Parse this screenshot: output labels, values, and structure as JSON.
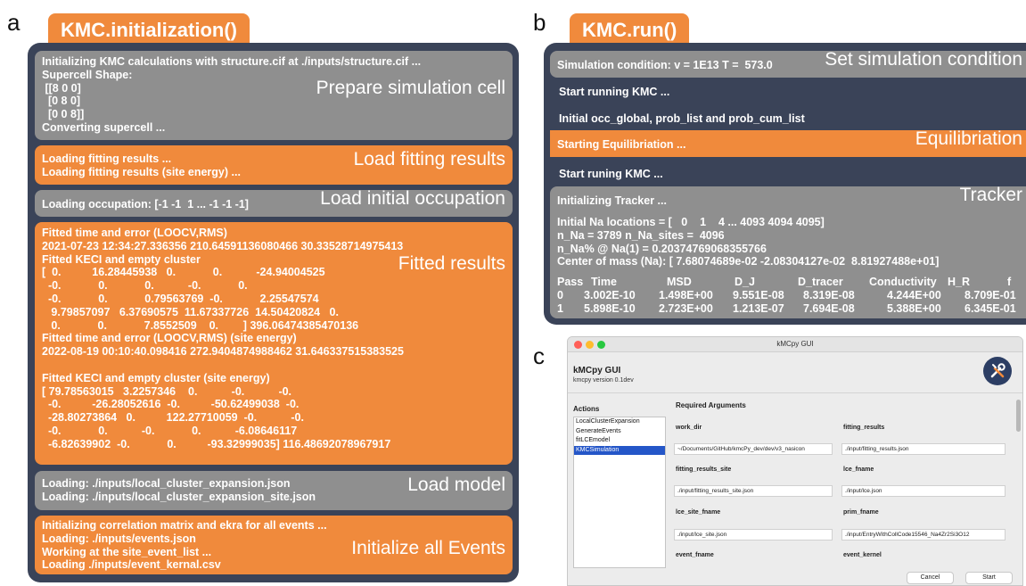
{
  "panel_a": {
    "letter": "a",
    "tab_title": "KMC.initialization()",
    "sections": [
      {
        "lines": [
          "Initializing KMC calculations with structure.cif at ./inputs/structure.cif ...",
          "Supercell Shape:",
          " [[8 0 0]",
          "  [0 8 0]",
          "  [0 0 8]]",
          "Converting supercell ..."
        ],
        "tag": "Prepare simulation cell"
      },
      {
        "lines": [
          "Loading fitting results ...",
          "Loading fitting results (site energy) ..."
        ],
        "tag": "Load fitting results"
      },
      {
        "lines": [
          "Loading occupation: [-1 -1  1 ... -1 -1 -1]"
        ],
        "tag": "Load initial occupation"
      },
      {
        "lines": [
          "Fitted time and error (LOOCV,RMS)",
          "2021-07-23 12:34:27.336356 210.64591136080466 30.33528714975413",
          "Fitted KECI and empty cluster",
          "[  0.          16.28445938   0.            0.           -24.94004525",
          "  -0.            0.            0.           -0.            0.",
          "  -0.            0.            0.79563769  -0.            2.25547574",
          "   9.79857097   6.37690575  11.67337726  14.50420824   0.",
          "   0.            0.            7.8552509    0.        ] 396.06474385470136",
          "Fitted time and error (LOOCV,RMS) (site energy)",
          "2022-08-19 00:10:40.098416 272.9404874988462 31.646337515383525",
          "",
          "Fitted KECI and empty cluster (site energy)",
          "[ 79.78563015   3.2257346    0.           -0.           -0.",
          "  -0.          -26.28052616  -0.          -50.62499038  -0.",
          "  -28.80273864   0.          122.27710059  -0.           -0.",
          "  -0.            0.           -0.            0.           -6.08646117",
          "  -6.82639902  -0.            0.          -93.32999035] 116.48692078967917"
        ],
        "tag": "Fitted results"
      },
      {
        "lines": [
          "Loading: ./inputs/local_cluster_expansion.json",
          "Loading: ./inputs/local_cluster_expansion_site.json"
        ],
        "tag": "Load model"
      },
      {
        "lines": [
          "Initializing correlation matrix and ekra for all events ...",
          "Loading: ./inputs/events.json",
          "Working at the site_event_list ...",
          "Loading ./inputs/event_kernal.csv"
        ],
        "tag": "Initialize all Events"
      }
    ]
  },
  "panel_b": {
    "letter": "b",
    "tab_title": "KMC.run()",
    "condition": {
      "text": "Simulation condition: v = 1E13 T =  573.0",
      "tag": "Set simulation condition"
    },
    "start_running": "Start running KMC ...",
    "initial_occ": "Initial occ_global, prob_list and prob_cum_list",
    "equilibration": {
      "text": "Starting Equilibriation ...",
      "tag": "Equilibriation"
    },
    "start_runing": "Start runing KMC ...",
    "tracker": {
      "title": "Initializing Tracker ...",
      "tag": "Tracker",
      "lines": [
        "Initial Na locations = [   0    1    4 ... 4093 4094 4095]",
        "n_Na = 3789 n_Na_sites =  4096",
        "n_Na% @ Na(1) = 0.20374769068355766",
        "Center of mass (Na): [ 7.68074689e-02 -2.08304127e-02  8.81927488e+01]"
      ],
      "table_header": [
        "Pass",
        "Time",
        "MSD",
        "D_J",
        "D_tracer",
        "Conductivity",
        "H_R",
        "f"
      ],
      "table_rows": [
        [
          "0",
          "3.002E-10",
          "1.498E+00",
          "9.551E-08",
          "8.319E-08",
          "4.244E+00",
          "",
          "8.709E-01"
        ],
        [
          "1",
          "5.898E-10",
          "2.723E+00",
          "1.213E-07",
          "7.694E-08",
          "5.388E+00",
          "",
          "6.345E-01"
        ]
      ]
    }
  },
  "panel_c": {
    "letter": "c",
    "window_title": "kMCpy GUI",
    "app_name": "kMCpy GUI",
    "app_version": "kmcpy version 0.1dev",
    "actions_label": "Actions",
    "actions": [
      "LocalClusterExpansion",
      "GenerateEvents",
      "fitLCEmodel",
      "KMCSimulation"
    ],
    "selected_action": "KMCSimulation",
    "required_label": "Required Arguments",
    "fields": [
      {
        "label": "work_dir",
        "value": "~/Documents/GitHub/kmcPy_dev/dev/v3_nasicon"
      },
      {
        "label": "fitting_results",
        "value": "./input/fitting_results.json"
      },
      {
        "label": "fitting_results_site",
        "value": "./input/fitting_results_site.json"
      },
      {
        "label": "lce_fname",
        "value": "./input/lce.json"
      },
      {
        "label": "lce_site_fname",
        "value": "./input/lce_site.json"
      },
      {
        "label": "prim_fname",
        "value": "./input/EntryWithCollCode15546_Na4Zr2Si3O12"
      },
      {
        "label": "event_fname",
        "value": ""
      },
      {
        "label": "event_kernel",
        "value": ""
      }
    ],
    "cancel_label": "Cancel",
    "start_label": "Start",
    "colors": {
      "close": "#ff5f57",
      "minimize": "#febc2e",
      "zoom": "#28c840",
      "selection": "#2456c8"
    }
  },
  "colors": {
    "frame": "#3a4358",
    "orange": "#f08a3c",
    "gray": "#8f8f8f"
  }
}
